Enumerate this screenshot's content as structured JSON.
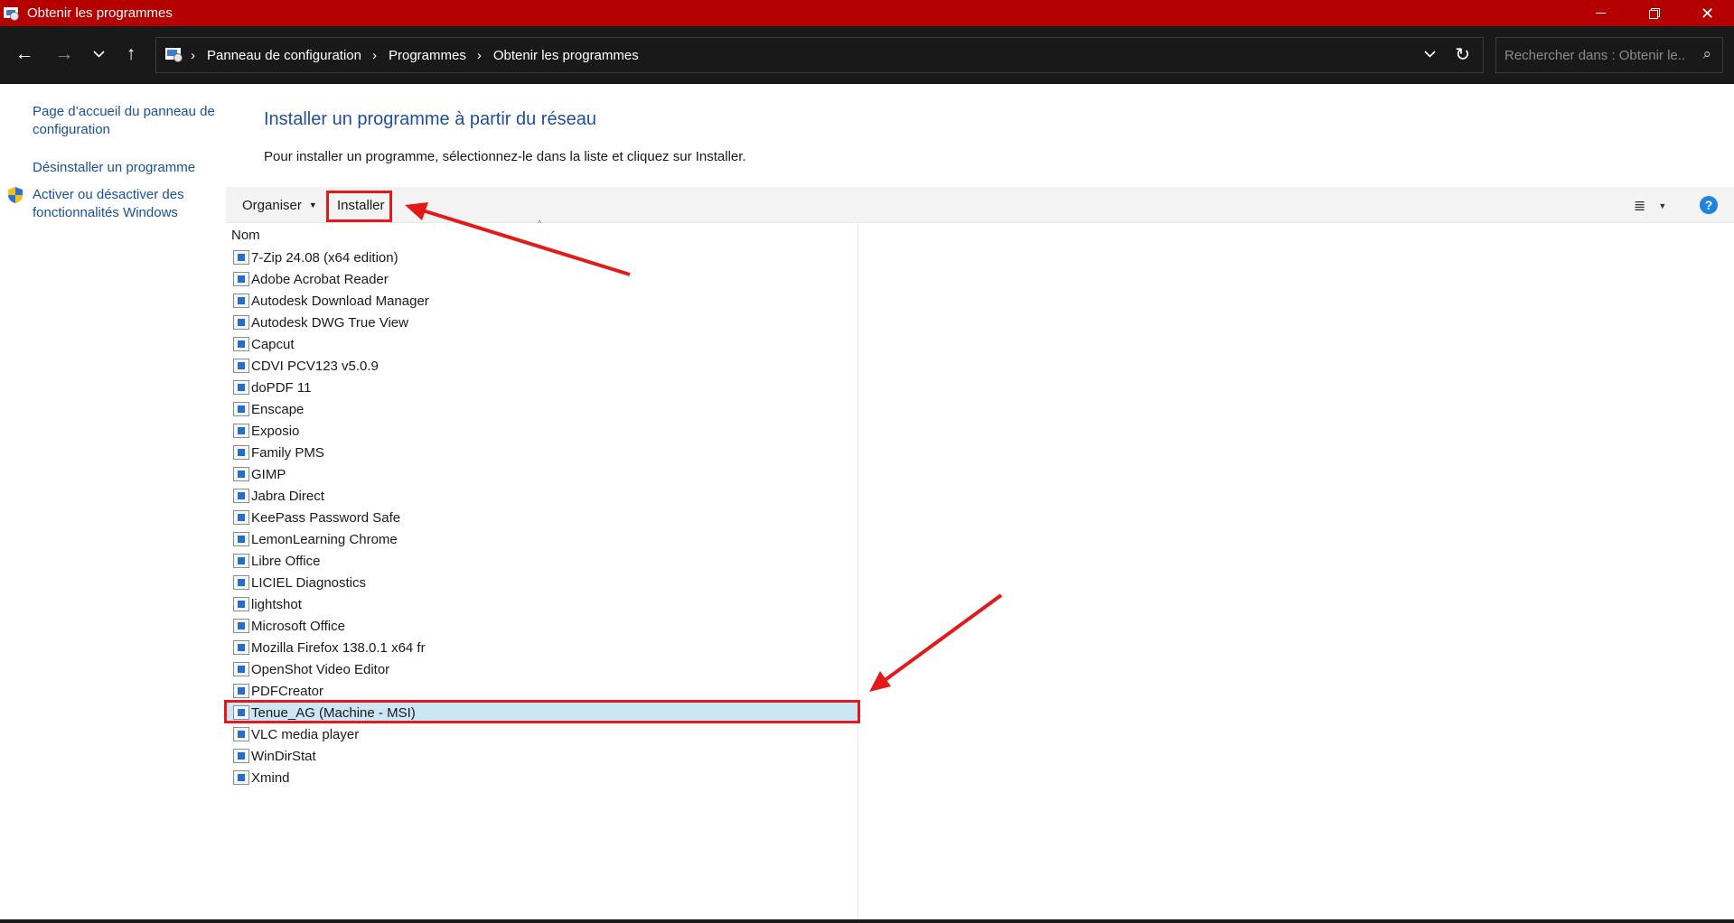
{
  "window": {
    "title": "Obtenir les programmes"
  },
  "nav": {
    "breadcrumbs": [
      "Panneau de configuration",
      "Programmes",
      "Obtenir les programmes"
    ],
    "search_placeholder": "Rechercher dans : Obtenir le..."
  },
  "sidebar": {
    "home_link": "Page d’accueil du panneau de configuration",
    "uninstall_link": "Désinstaller un programme",
    "features_link": "Activer ou désactiver des fonctionnalités Windows"
  },
  "main": {
    "heading": "Installer un programme à partir du réseau",
    "instruction": "Pour installer un programme, sélectionnez-le dans la liste et cliquez sur Installer.",
    "organize_label": "Organiser",
    "install_label": "Installer",
    "column_name": "Nom"
  },
  "programs": [
    "7-Zip 24.08 (x64 edition)",
    "Adobe Acrobat Reader",
    "Autodesk Download Manager",
    "Autodesk DWG True View",
    "Capcut",
    "CDVI PCV123 v5.0.9",
    "doPDF 11",
    "Enscape",
    "Exposio",
    "Family PMS",
    "GIMP",
    "Jabra Direct",
    "KeePass Password Safe",
    "LemonLearning Chrome",
    "Libre Office",
    "LICIEL Diagnostics",
    "lightshot",
    "Microsoft Office",
    "Mozilla Firefox 138.0.1 x64 fr",
    "OpenShot Video Editor",
    "PDFCreator",
    "Tenue_AG (Machine - MSI)",
    "VLC media player",
    "WinDirStat",
    "Xmind"
  ],
  "selected_program": "Tenue_AG (Machine - MSI)",
  "colors": {
    "titlebar": "#b50000",
    "link": "#1a4f9c",
    "heading": "#1e4e9c",
    "selection": "#cce6f7",
    "annotation": "#e21a1a"
  }
}
